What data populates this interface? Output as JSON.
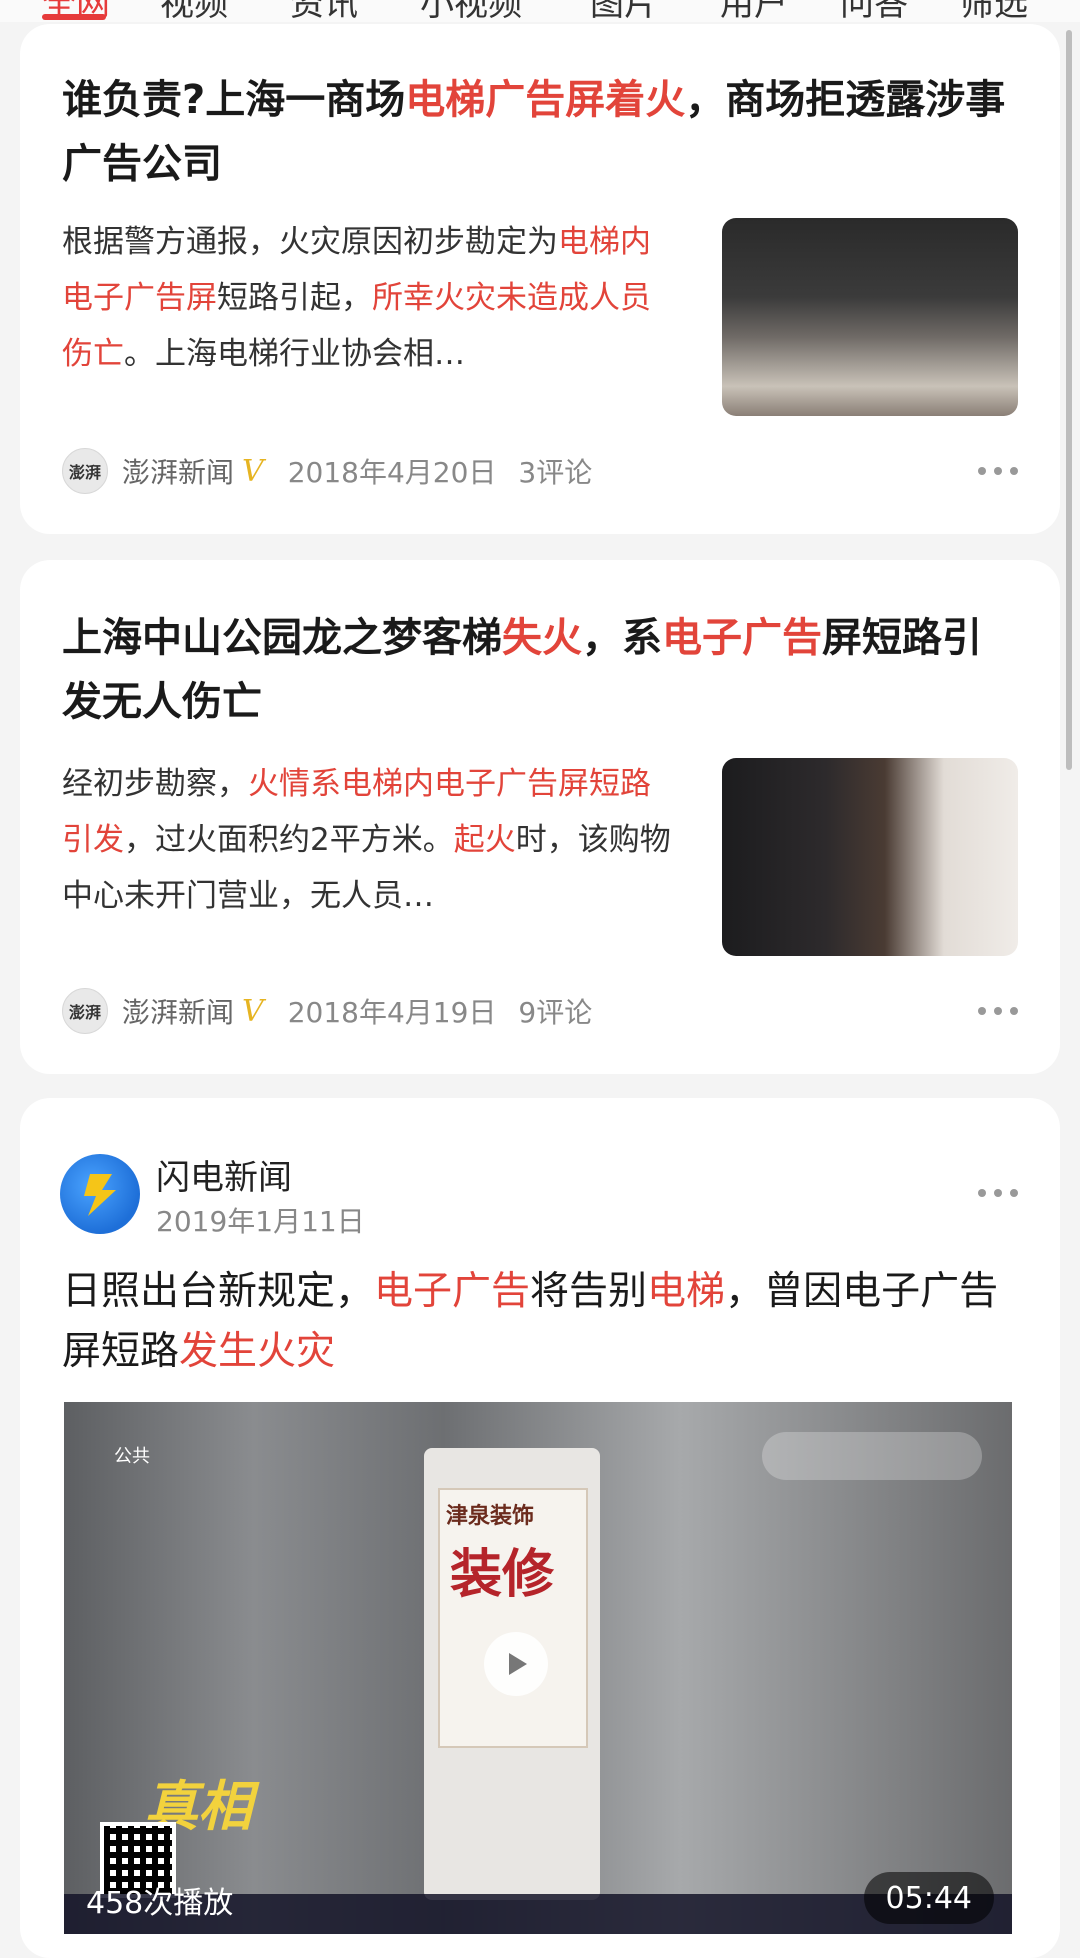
{
  "nav": {
    "tabs": [
      {
        "label": "全网"
      },
      {
        "label": "视频"
      },
      {
        "label": "资讯"
      },
      {
        "label": "小视频"
      },
      {
        "label": "图片"
      },
      {
        "label": "用户"
      },
      {
        "label": "问答"
      },
      {
        "label": "筛选"
      }
    ]
  },
  "articles": [
    {
      "title_parts": [
        {
          "text": "谁负责?上海一商场",
          "hl": false
        },
        {
          "text": "电梯广告屏着火",
          "hl": true
        },
        {
          "text": "，商场拒透露涉事广告公司",
          "hl": false
        }
      ],
      "summary_parts": [
        {
          "text": "根据警方通报，火灾原因初步勘定为",
          "hl": false
        },
        {
          "text": "电梯内电子广告屏",
          "hl": true
        },
        {
          "text": "短路引起，",
          "hl": false
        },
        {
          "text": "所幸火灾未造成人员伤亡",
          "hl": true
        },
        {
          "text": "。上海电梯行业协会相…",
          "hl": false
        }
      ],
      "source": "澎湃新闻",
      "avatar_text": "澎湃",
      "verified": "V",
      "date": "2018年4月20日",
      "comments": "3评论"
    },
    {
      "title_parts": [
        {
          "text": "上海中山公园龙之梦客梯",
          "hl": false
        },
        {
          "text": "失火",
          "hl": true
        },
        {
          "text": "，系",
          "hl": false
        },
        {
          "text": "电子广告",
          "hl": true
        },
        {
          "text": "屏短路引发无人伤亡",
          "hl": false
        }
      ],
      "summary_parts": [
        {
          "text": "经初步勘察，",
          "hl": false
        },
        {
          "text": "火情系电梯内电子广告屏短路引发",
          "hl": true
        },
        {
          "text": "，过火面积约2平方米。",
          "hl": false
        },
        {
          "text": "起火",
          "hl": true
        },
        {
          "text": "时，该购物中心未开门营业，无人员…",
          "hl": false
        }
      ],
      "source": "澎湃新闻",
      "avatar_text": "澎湃",
      "verified": "V",
      "date": "2018年4月19日",
      "comments": "9评论"
    }
  ],
  "video_post": {
    "publisher": "闪电新闻",
    "date": "2019年1月11日",
    "title_parts": [
      {
        "text": "日照出台新规定，",
        "hl": false
      },
      {
        "text": "电子广告",
        "hl": true
      },
      {
        "text": "将告别",
        "hl": false
      },
      {
        "text": "电梯",
        "hl": true
      },
      {
        "text": "，曾因电子广告屏短路",
        "hl": false
      },
      {
        "text": "发生火灾",
        "hl": true
      }
    ],
    "play_count": "458次播放",
    "duration": "05:44",
    "overlay": {
      "channel": "公共",
      "ad_brand": "津泉装饰",
      "ad_big": "装修",
      "stamp": "真相"
    }
  },
  "colors": {
    "highlight": "#e2443a",
    "verified": "#e6b422",
    "card_bg": "#ffffff",
    "page_bg": "#f4f4f4"
  }
}
